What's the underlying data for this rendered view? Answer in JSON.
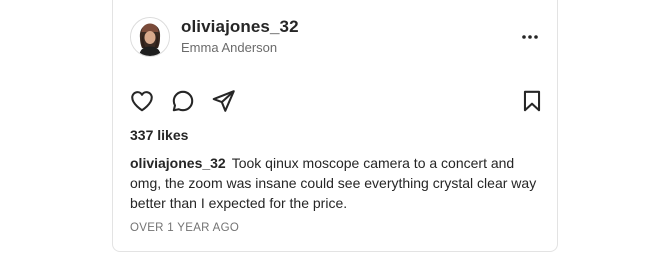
{
  "post": {
    "username": "oliviajones_32",
    "full_name": "Emma Anderson",
    "likes": "337 likes",
    "caption_user": "oliviajones_32",
    "caption_text": "Took qinux moscope camera to a concert and omg, the zoom was insane could see everything crystal clear way better than I expected for the price.",
    "timestamp": "OVER 1 YEAR AGO"
  },
  "icons": {
    "more": "more-options-icon",
    "like": "heart-icon",
    "comment": "comment-icon",
    "share": "send-icon",
    "save": "bookmark-icon"
  }
}
